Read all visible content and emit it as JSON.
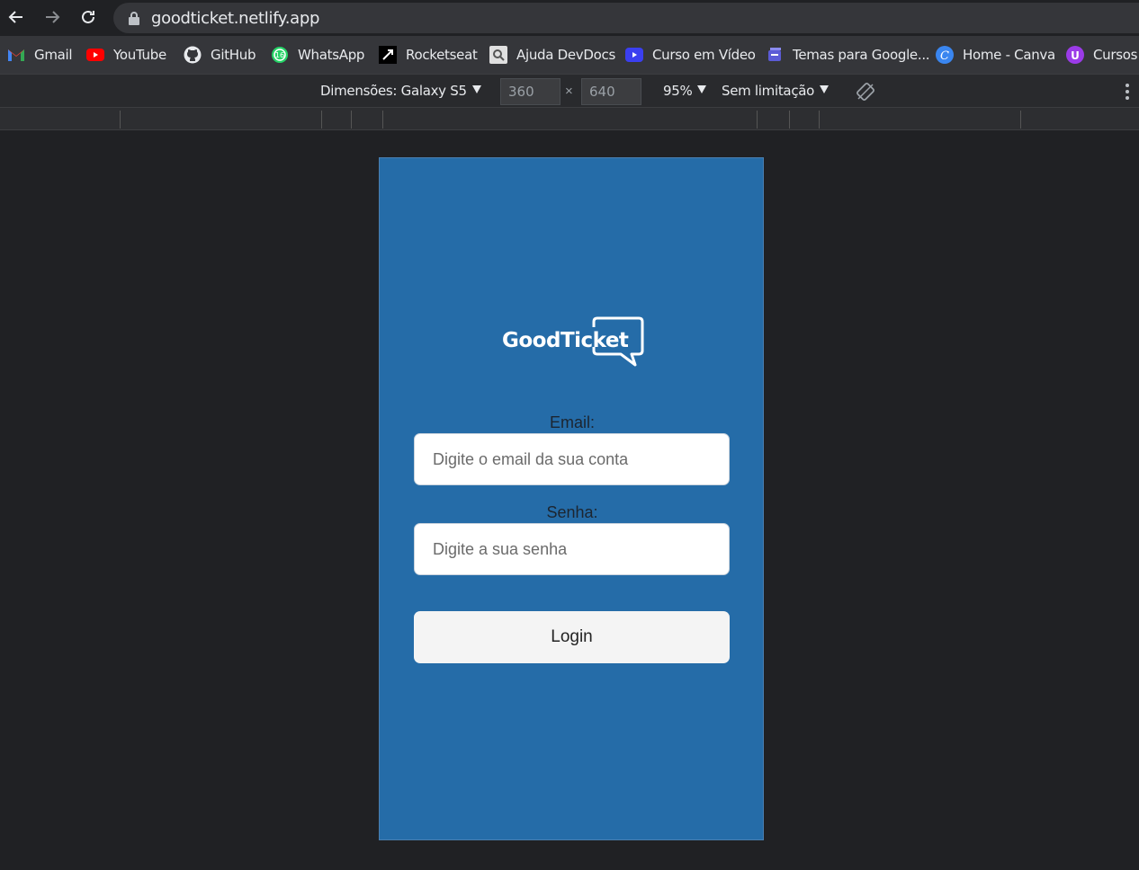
{
  "browser": {
    "url": "goodticket.netlify.app"
  },
  "bookmarks": [
    {
      "label": "Gmail",
      "icon": "gmail-icon"
    },
    {
      "label": "YouTube",
      "icon": "youtube-icon"
    },
    {
      "label": "GitHub",
      "icon": "github-icon"
    },
    {
      "label": "WhatsApp",
      "icon": "whatsapp-icon"
    },
    {
      "label": "Rocketseat",
      "icon": "rocketseat-icon"
    },
    {
      "label": "Ajuda DevDocs",
      "icon": "devdocs-icon"
    },
    {
      "label": "Curso em Vídeo",
      "icon": "cursoemvideo-icon"
    },
    {
      "label": "Temas para Google...",
      "icon": "themes-icon"
    },
    {
      "label": "Home - Canva",
      "icon": "canva-icon"
    },
    {
      "label": "Cursos e",
      "icon": "cursos-icon"
    }
  ],
  "device_toolbar": {
    "dimensions_label": "Dimensões: Galaxy S5",
    "width": "360",
    "height": "640",
    "times": "×",
    "zoom": "95%",
    "throttle": "Sem limitação"
  },
  "app": {
    "logo_text": "GoodTicket",
    "email_label": "Email:",
    "email_placeholder": "Digite o email da sua conta",
    "password_label": "Senha:",
    "password_placeholder": "Digite a sua senha",
    "login_label": "Login",
    "colors": {
      "background": "#256ca8",
      "button": "#f4f4f4"
    }
  }
}
